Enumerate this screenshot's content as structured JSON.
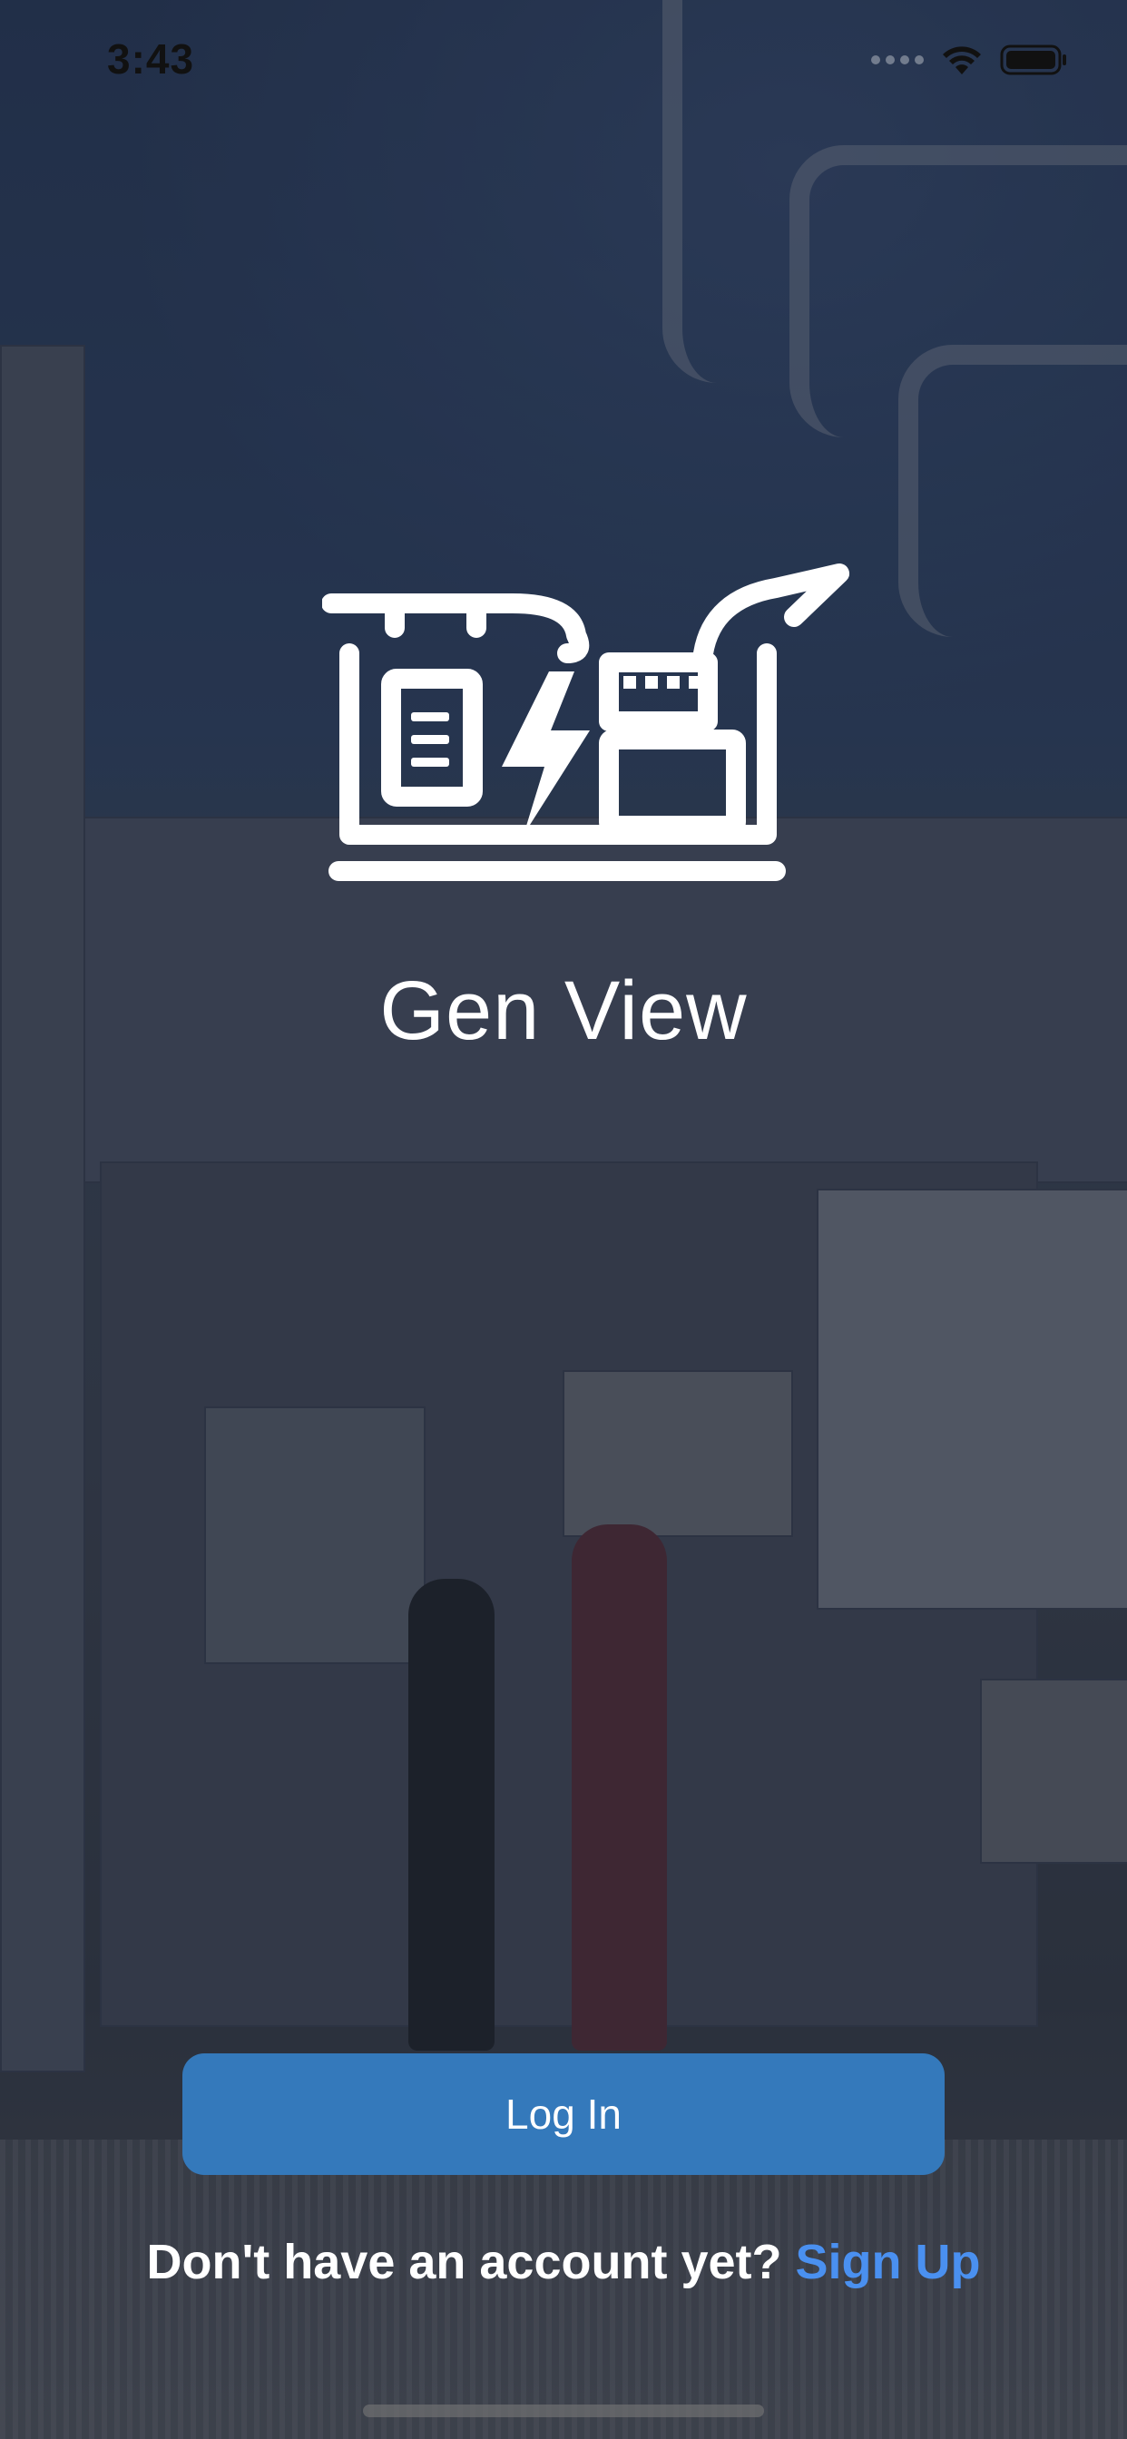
{
  "status_bar": {
    "time": "3:43",
    "icons": [
      "signal-icon",
      "wifi-icon",
      "battery-icon"
    ]
  },
  "app": {
    "title": "Gen View",
    "logo_icon": "generator-icon"
  },
  "actions": {
    "login_label": "Log In",
    "signup_prompt": "Don't have an account yet?",
    "signup_label": "Sign Up"
  },
  "colors": {
    "button": "#3479bb",
    "link": "#4a90f0",
    "text": "#ffffff"
  }
}
